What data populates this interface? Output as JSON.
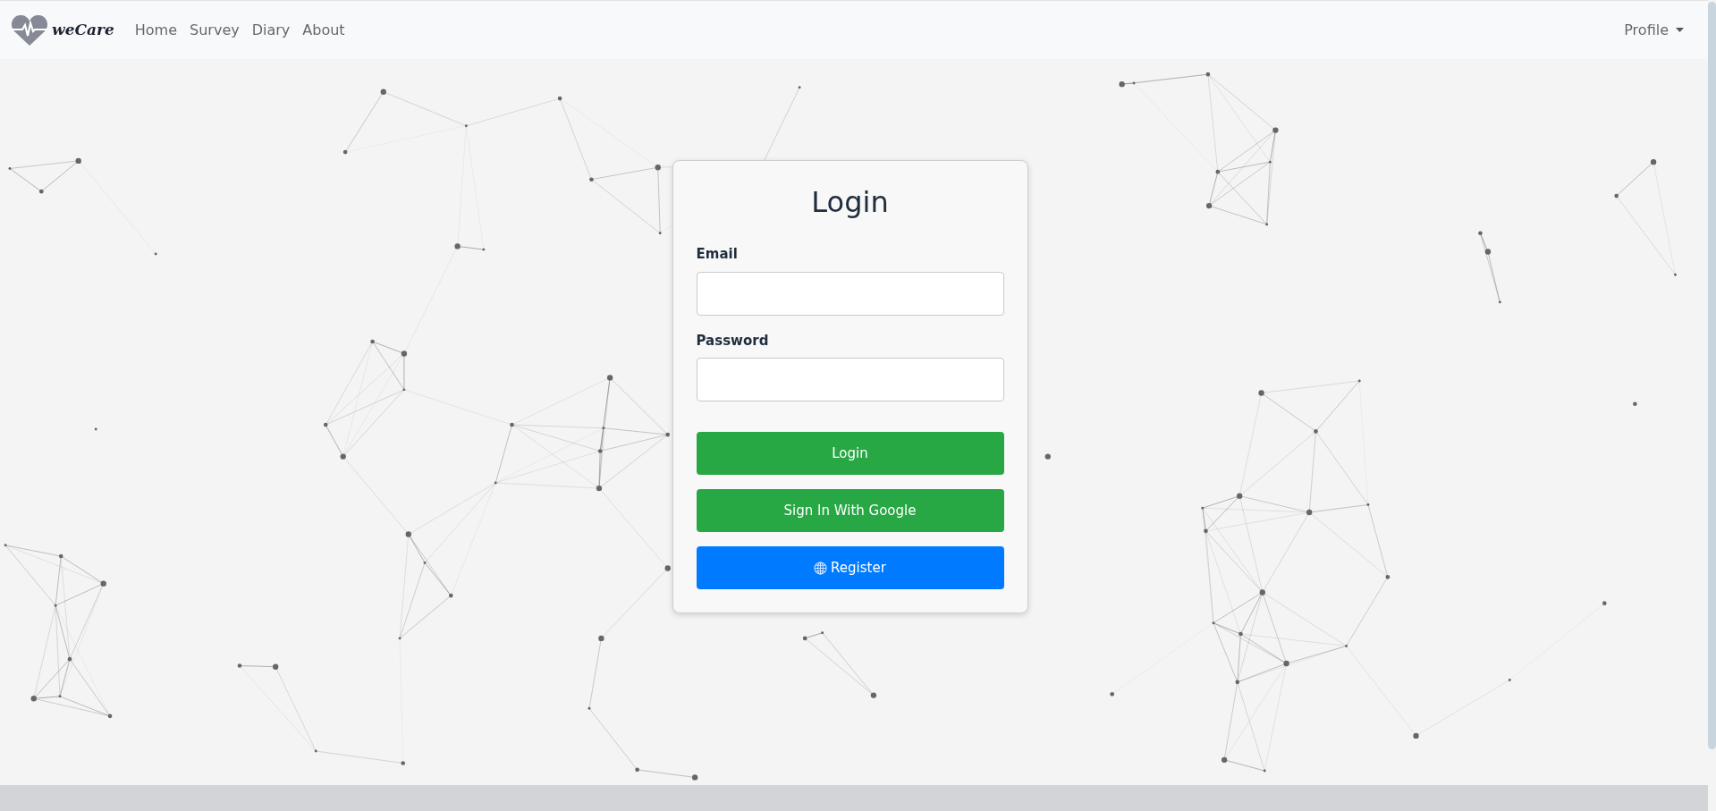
{
  "navbar": {
    "brand": "weCare",
    "links": [
      {
        "label": "Home"
      },
      {
        "label": "Survey"
      },
      {
        "label": "Diary"
      },
      {
        "label": "About"
      }
    ],
    "profile": "Profile"
  },
  "login": {
    "title": "Login",
    "fields": [
      {
        "label": "Email"
      },
      {
        "label": "Password"
      }
    ],
    "buttons": [
      {
        "label": "Login",
        "kind": "success"
      },
      {
        "label": "Sign In With Google",
        "kind": "success"
      },
      {
        "label": "Register",
        "kind": "primary"
      }
    ]
  }
}
